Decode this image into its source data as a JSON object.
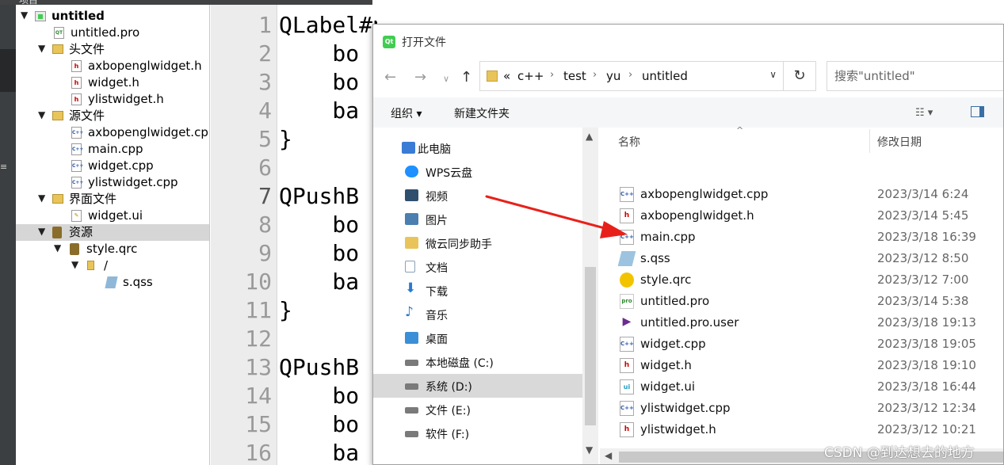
{
  "ide": {
    "topbar_label": "项目",
    "project_tree": [
      {
        "label": "untitled",
        "bold": true,
        "icon": "qt-project-icon",
        "arrow": "▼"
      },
      {
        "label": "untitled.pro",
        "icon": "pro-file-icon"
      },
      {
        "label": "头文件",
        "icon": "folder-icon",
        "arrow": "▼"
      },
      {
        "label": "axbopenglwidget.h",
        "icon": "header-file-icon"
      },
      {
        "label": "widget.h",
        "icon": "header-file-icon"
      },
      {
        "label": "ylistwidget.h",
        "icon": "header-file-icon"
      },
      {
        "label": "源文件",
        "icon": "folder-icon",
        "arrow": "▼"
      },
      {
        "label": "axbopenglwidget.cpp",
        "icon": "cpp-file-icon"
      },
      {
        "label": "main.cpp",
        "icon": "cpp-file-icon"
      },
      {
        "label": "widget.cpp",
        "icon": "cpp-file-icon"
      },
      {
        "label": "ylistwidget.cpp",
        "icon": "cpp-file-icon"
      },
      {
        "label": "界面文件",
        "icon": "folder-icon",
        "arrow": "▼"
      },
      {
        "label": "widget.ui",
        "icon": "ui-file-icon"
      },
      {
        "label": "资源",
        "icon": "resource-folder-icon",
        "arrow": "▼",
        "selected": true
      },
      {
        "label": "style.qrc",
        "icon": "qrc-file-icon",
        "arrow": "▼"
      },
      {
        "label": "/",
        "icon": "folder-icon",
        "arrow": "▼"
      },
      {
        "label": "s.qss",
        "icon": "qss-file-icon"
      }
    ],
    "editor": {
      "line_numbers": [
        "1",
        "2",
        "3",
        "4",
        "5",
        "6",
        "7",
        "8",
        "9",
        "10",
        "11",
        "12",
        "13",
        "14",
        "15",
        "16"
      ],
      "current_line": "7",
      "lines": [
        "QLabel#pulley {",
        "    bo",
        "    bo",
        "    ba",
        "}",
        "",
        "QPushB",
        "    bo",
        "    bo",
        "    ba",
        "}",
        "",
        "QPushB",
        "    bo",
        "    bo",
        "    ba"
      ]
    }
  },
  "dialog": {
    "title": "打开文件",
    "app_icon_text": "Qt",
    "address": {
      "overflow": "«",
      "crumbs": [
        "c++",
        "test",
        "yu",
        "untitled"
      ]
    },
    "search_placeholder": "搜索\"untitled\"",
    "toolbar": {
      "organize": "组织 ▾",
      "new_folder": "新建文件夹"
    },
    "nav": {
      "items": [
        {
          "label": "此电脑",
          "icon": "computer-icon",
          "color": "#3a7bd5"
        },
        {
          "label": "WPS云盘",
          "icon": "cloud-icon",
          "color": "#1e90ff"
        },
        {
          "label": "视频",
          "icon": "video-icon",
          "color": "#2f4f6f"
        },
        {
          "label": "图片",
          "icon": "picture-icon",
          "color": "#4a7fb0"
        },
        {
          "label": "微云同步助手",
          "icon": "folder-icon",
          "color": "#e8c45a"
        },
        {
          "label": "文档",
          "icon": "document-icon",
          "color": "#8aa0b8"
        },
        {
          "label": "下载",
          "icon": "download-icon",
          "color": "#2a7ad2"
        },
        {
          "label": "音乐",
          "icon": "music-icon",
          "color": "#2a7ad2"
        },
        {
          "label": "桌面",
          "icon": "desktop-icon",
          "color": "#3a8fd6"
        },
        {
          "label": "本地磁盘 (C:)",
          "icon": "drive-c-icon",
          "color": "#7a7a7a"
        },
        {
          "label": "系统 (D:)",
          "icon": "drive-icon",
          "color": "#7a7a7a",
          "selected": true
        },
        {
          "label": "文件 (E:)",
          "icon": "drive-icon",
          "color": "#7a7a7a"
        },
        {
          "label": "软件 (F:)",
          "icon": "drive-icon",
          "color": "#7a7a7a"
        }
      ]
    },
    "columns": {
      "name": "名称",
      "modified": "修改日期"
    },
    "files": [
      {
        "name": "axbopenglwidget.cpp",
        "date": "2023/3/14 6:24",
        "type": "cpp",
        "badge": "C++"
      },
      {
        "name": "axbopenglwidget.h",
        "date": "2023/3/14 5:45",
        "type": "h",
        "badge": "h"
      },
      {
        "name": "main.cpp",
        "date": "2023/3/18 16:39",
        "type": "cpp",
        "badge": "C++"
      },
      {
        "name": "s.qss",
        "date": "2023/3/12 8:50",
        "type": "qss",
        "badge": ""
      },
      {
        "name": "style.qrc",
        "date": "2023/3/12 7:00",
        "type": "qrc",
        "badge": ""
      },
      {
        "name": "untitled.pro",
        "date": "2023/3/14 5:38",
        "type": "pro",
        "badge": "pro"
      },
      {
        "name": "untitled.pro.user",
        "date": "2023/3/18 19:13",
        "type": "user",
        "badge": "▶"
      },
      {
        "name": "widget.cpp",
        "date": "2023/3/18 19:05",
        "type": "cpp",
        "badge": "C++"
      },
      {
        "name": "widget.h",
        "date": "2023/3/18 19:10",
        "type": "h",
        "badge": "h"
      },
      {
        "name": "widget.ui",
        "date": "2023/3/18 16:44",
        "type": "ui",
        "badge": "ui"
      },
      {
        "name": "ylistwidget.cpp",
        "date": "2023/3/12 12:34",
        "type": "cpp",
        "badge": "C++"
      },
      {
        "name": "ylistwidget.h",
        "date": "2023/3/12 10:21",
        "type": "h",
        "badge": "h"
      }
    ]
  },
  "annotation_color": "#e8201a",
  "watermark": "CSDN @到达想去的地方"
}
